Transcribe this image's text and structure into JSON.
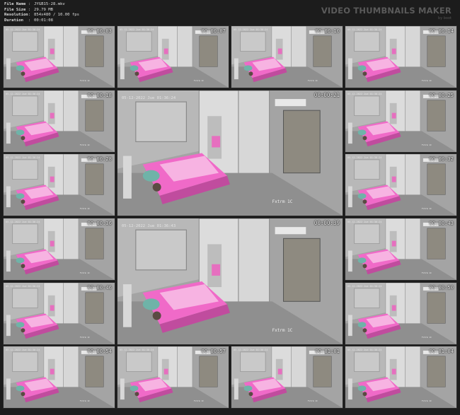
{
  "file_info": [
    {
      "label": "File Name",
      "value": "JYGB15-28.mkv"
    },
    {
      "label": "File Size",
      "value": "29.79 MB"
    },
    {
      "label": "Resolution",
      "value": "854x480 / 10.00 fps"
    },
    {
      "label": "Duration",
      "value": "00:01:08"
    }
  ],
  "brand": {
    "title": "VIDEO THUMBNAILS MAKER",
    "subtitle": "by boot"
  },
  "overlay_time": [
    "05-12-2022 Jue 01:36:24",
    "05-12-2022 Jue 01:36:43"
  ],
  "thumbnails": [
    "00:00:03",
    "00:00:07",
    "00:00:10",
    "00:00:14",
    "00:00:18",
    "00:00:21",
    "00:00:25",
    "00:00:28",
    "00:00:32",
    "00:00:36",
    "00:00:39",
    "00:00:43",
    "00:00:46",
    "00:00:50",
    "00:00:54",
    "00:00:57",
    "00:01:01",
    "00:01:04"
  ]
}
